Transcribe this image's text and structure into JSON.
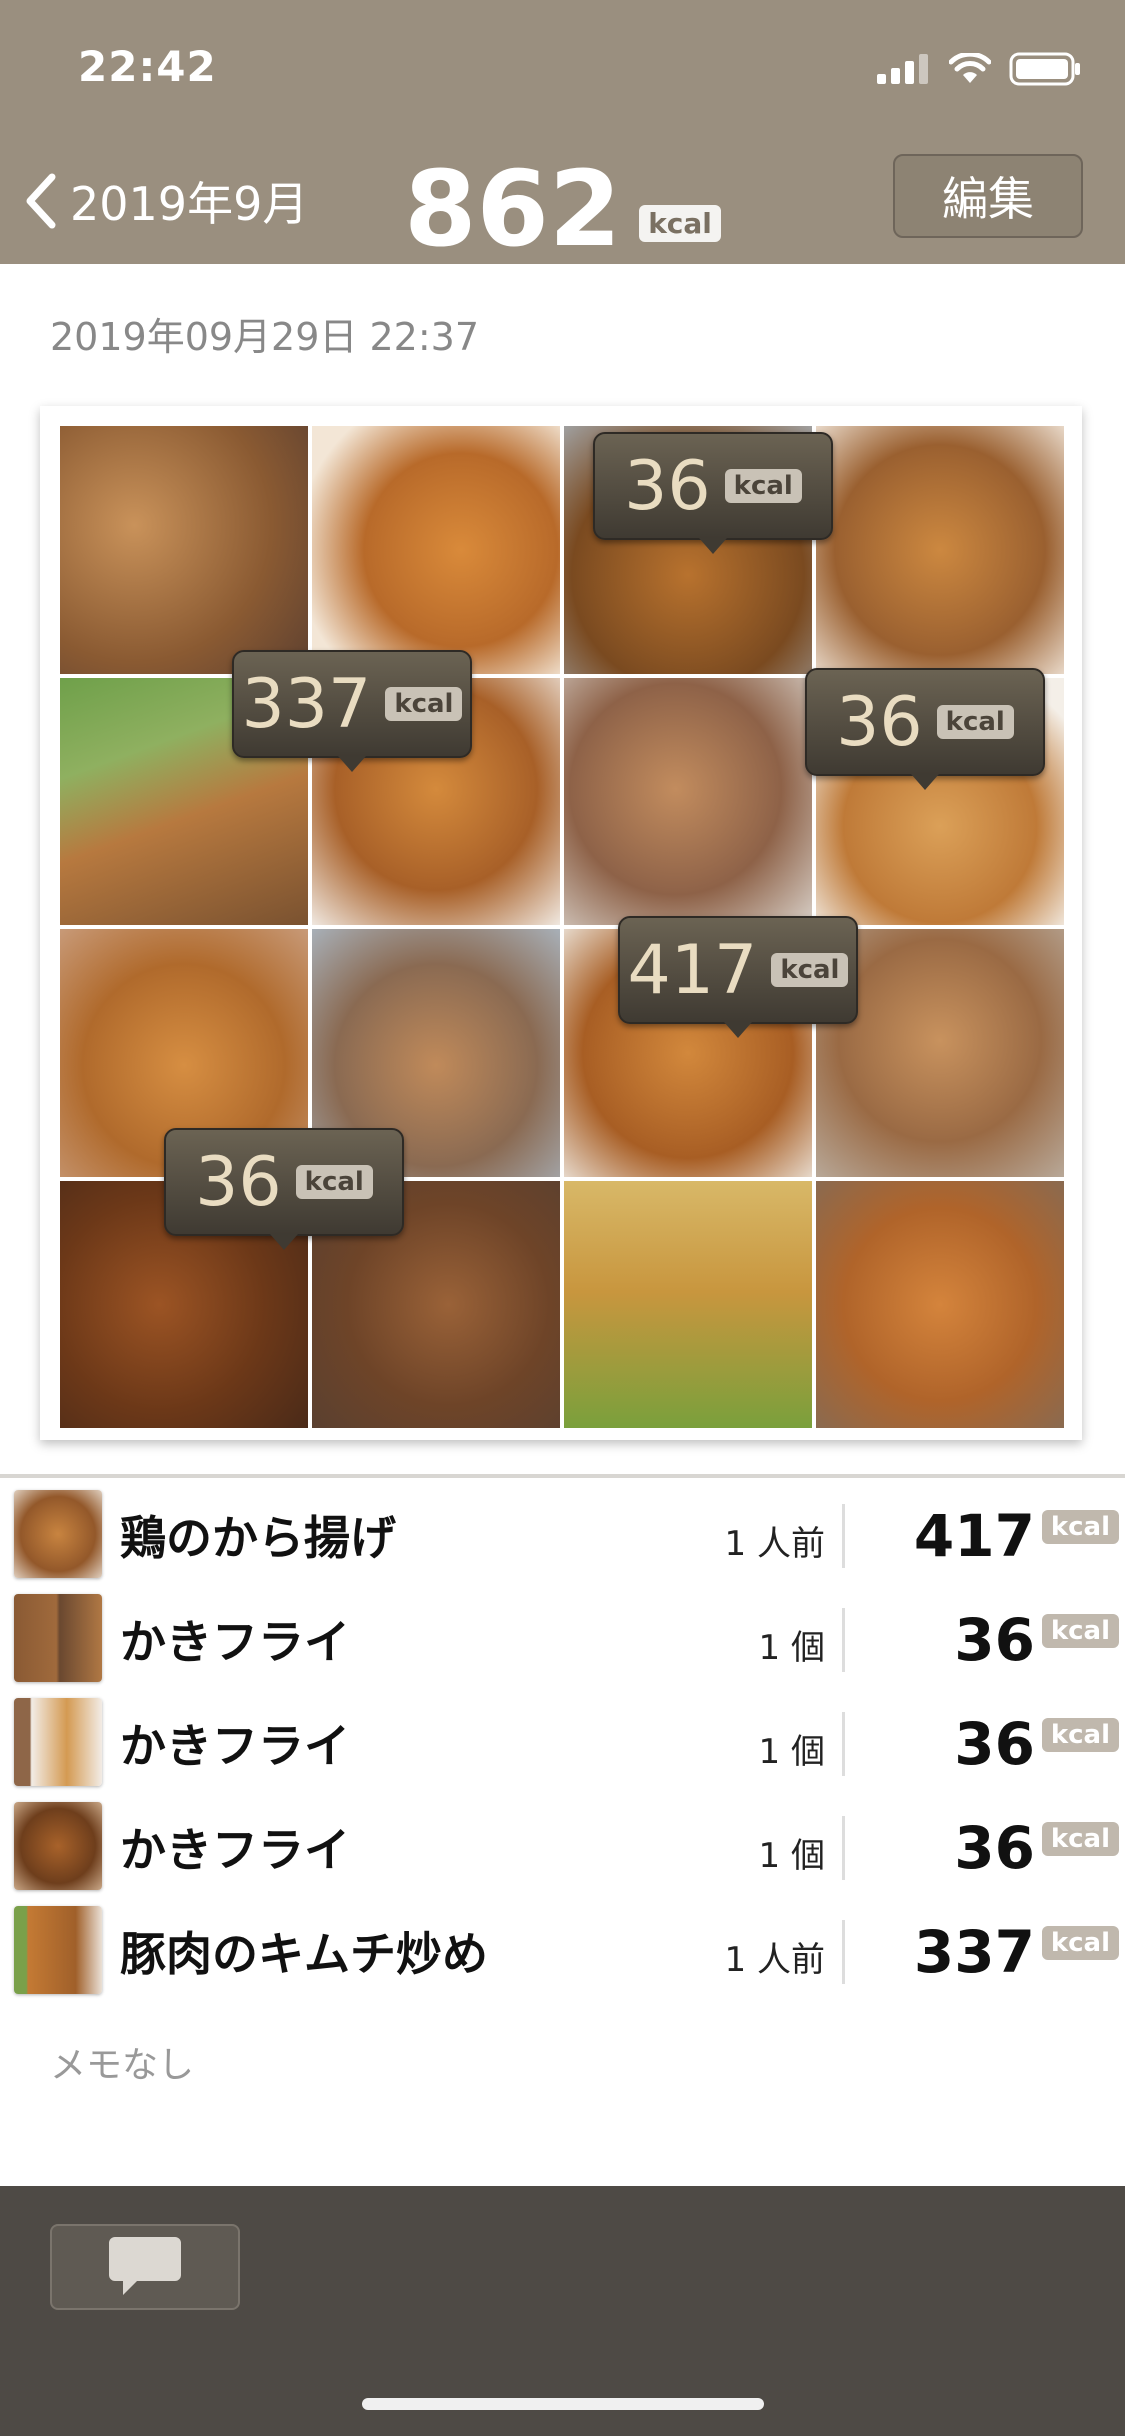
{
  "status": {
    "time": "22:42"
  },
  "header": {
    "back_label": "2019年9月",
    "total_kcal": "862",
    "kcal_unit": "kcal",
    "edit_label": "編集"
  },
  "meal": {
    "datetime": "2019年09月29日 22:37"
  },
  "photo_bubbles": [
    {
      "value": "36",
      "unit": "kcal"
    },
    {
      "value": "337",
      "unit": "kcal"
    },
    {
      "value": "36",
      "unit": "kcal"
    },
    {
      "value": "417",
      "unit": "kcal"
    },
    {
      "value": "36",
      "unit": "kcal"
    }
  ],
  "items": [
    {
      "name": "鶏のから揚げ",
      "portion": "1 人前",
      "kcal": "417",
      "unit": "kcal"
    },
    {
      "name": "かきフライ",
      "portion": "1 個",
      "kcal": "36",
      "unit": "kcal"
    },
    {
      "name": "かきフライ",
      "portion": "1 個",
      "kcal": "36",
      "unit": "kcal"
    },
    {
      "name": "かきフライ",
      "portion": "1 個",
      "kcal": "36",
      "unit": "kcal"
    },
    {
      "name": "豚肉のキムチ炒め",
      "portion": "1 人前",
      "kcal": "337",
      "unit": "kcal"
    }
  ],
  "memo": "メモなし",
  "colors": {
    "header": "#9a8f7f",
    "bottom_bar": "#4e4a45",
    "kcal_badge": "#c0b8ad"
  },
  "icons": [
    "back-chevron-icon",
    "signal-icon",
    "wifi-icon",
    "battery-icon",
    "comment-bubble-icon"
  ]
}
